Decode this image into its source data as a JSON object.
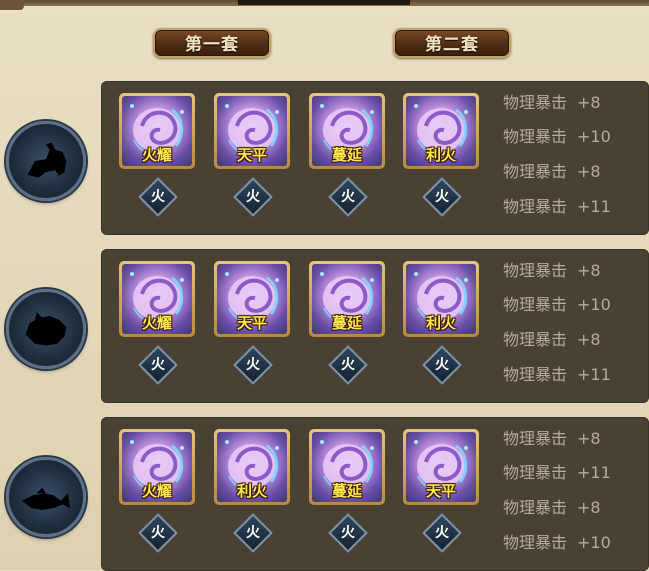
{
  "tabs": [
    {
      "label": "第一套"
    },
    {
      "label": "第二套"
    }
  ],
  "sets": [
    {
      "pet_silhouette": "horse-rider-silhouette",
      "cards": [
        {
          "label": "火耀",
          "element": "火"
        },
        {
          "label": "天平",
          "element": "火"
        },
        {
          "label": "蔓延",
          "element": "火"
        },
        {
          "label": "利火",
          "element": "火"
        }
      ],
      "stats": [
        {
          "name": "物理暴击",
          "value": "+8"
        },
        {
          "name": "物理暴击",
          "value": "+10"
        },
        {
          "name": "物理暴击",
          "value": "+8"
        },
        {
          "name": "物理暴击",
          "value": "+11"
        }
      ]
    },
    {
      "pet_silhouette": "beast-silhouette",
      "cards": [
        {
          "label": "火耀",
          "element": "火"
        },
        {
          "label": "天平",
          "element": "火"
        },
        {
          "label": "蔓延",
          "element": "火"
        },
        {
          "label": "利火",
          "element": "火"
        }
      ],
      "stats": [
        {
          "name": "物理暴击",
          "value": "+8"
        },
        {
          "name": "物理暴击",
          "value": "+10"
        },
        {
          "name": "物理暴击",
          "value": "+8"
        },
        {
          "name": "物理暴击",
          "value": "+11"
        }
      ]
    },
    {
      "pet_silhouette": "fish-silhouette",
      "cards": [
        {
          "label": "火耀",
          "element": "火"
        },
        {
          "label": "利火",
          "element": "火"
        },
        {
          "label": "蔓延",
          "element": "火"
        },
        {
          "label": "天平",
          "element": "火"
        }
      ],
      "stats": [
        {
          "name": "物理暴击",
          "value": "+8"
        },
        {
          "name": "物理暴击",
          "value": "+11"
        },
        {
          "name": "物理暴击",
          "value": "+8"
        },
        {
          "name": "物理暴击",
          "value": "+10"
        }
      ]
    }
  ],
  "colors": {
    "card_label": "#ffe84a",
    "stat_text": "#b5ab9a",
    "panel_bg": "#4a4135"
  }
}
